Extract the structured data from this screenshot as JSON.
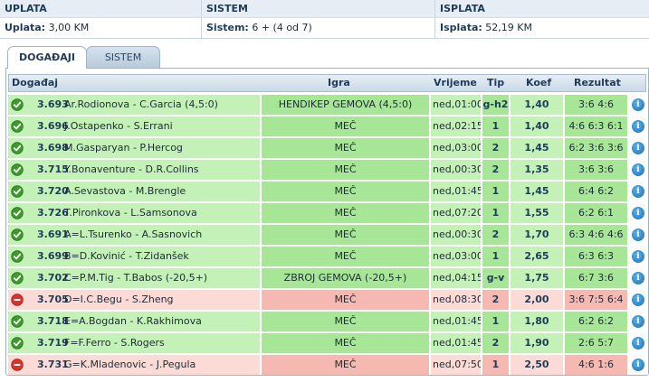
{
  "summary": {
    "uplata_header": "UPLATA",
    "sistem_header": "SISTEM",
    "isplata_header": "ISPLATA",
    "uplata_label": "Uplata:",
    "uplata_value": "3,00 KM",
    "sistem_label": "Sistem:",
    "sistem_value": "6 + (4 od 7)",
    "isplata_label": "Isplata:",
    "isplata_value": "52,19 KM"
  },
  "tabs": [
    {
      "label": "DOGAĐAJI",
      "active": true
    },
    {
      "label": "SISTEM",
      "active": false
    }
  ],
  "columns": {
    "event": "Događaj",
    "igra": "Igra",
    "vrijeme": "Vrijeme",
    "tip": "Tip",
    "koef": "Koef",
    "rezultat": "Rezultat"
  },
  "colors": {
    "won_light": "#c3f1b7",
    "won_dark": "#a7e597",
    "lost_light": "#fcdad6",
    "lost_dark": "#f6b9b1",
    "header_text": "#1e3b57"
  },
  "rows": [
    {
      "status": "won",
      "code": "3.693",
      "names": "Ar.Rodionova - C.Garcia (4,5:0)",
      "igra": "HENDIKEP GEMOVA (4,5:0)",
      "vrijeme": "ned,01:00",
      "tip": "g-h2",
      "koef": "1,40",
      "rezultat": "3:6 4:6",
      "info": "i"
    },
    {
      "status": "won",
      "code": "3.696",
      "names": "J.Ostapenko - S.Errani",
      "igra": "MEČ",
      "vrijeme": "ned,02:15",
      "tip": "1",
      "koef": "1,40",
      "rezultat": "4:6 6:3 6:1",
      "info": "i"
    },
    {
      "status": "won",
      "code": "3.698",
      "names": "M.Gasparyan - P.Hercog",
      "igra": "MEČ",
      "vrijeme": "ned,03:00",
      "tip": "2",
      "koef": "1,45",
      "rezultat": "6:2 3:6 3:6",
      "info": "i"
    },
    {
      "status": "won",
      "code": "3.715",
      "names": "Y.Bonaventure - D.R.Collins",
      "igra": "MEČ",
      "vrijeme": "ned,00:30",
      "tip": "2",
      "koef": "1,35",
      "rezultat": "3:6 3:6",
      "info": "i"
    },
    {
      "status": "won",
      "code": "3.720",
      "names": "A.Sevastova - M.Brengle",
      "igra": "MEČ",
      "vrijeme": "ned,01:45",
      "tip": "1",
      "koef": "1,45",
      "rezultat": "6:4 6:2",
      "info": "i"
    },
    {
      "status": "won",
      "code": "3.726",
      "names": "T.Pironkova - L.Samsonova",
      "igra": "MEČ",
      "vrijeme": "ned,07:20",
      "tip": "1",
      "koef": "1,55",
      "rezultat": "6:2 6:1",
      "info": "i"
    },
    {
      "status": "won",
      "code": "3.691",
      "names": "A=L.Tsurenko - A.Sasnovich",
      "igra": "MEČ",
      "vrijeme": "ned,00:30",
      "tip": "2",
      "koef": "1,70",
      "rezultat": "6:3 4:6 4:6",
      "info": "i"
    },
    {
      "status": "won",
      "code": "3.699",
      "names": "B=D.Kovinić - T.Zidanšek",
      "igra": "MEČ",
      "vrijeme": "ned,03:00",
      "tip": "1",
      "koef": "2,65",
      "rezultat": "6:3 6:3",
      "info": "i"
    },
    {
      "status": "won",
      "code": "3.702",
      "names": "C=P.M.Tig - T.Babos (-20,5+)",
      "igra": "ZBROJ GEMOVA (-20,5+)",
      "vrijeme": "ned,04:15",
      "tip": "g-v",
      "koef": "1,75",
      "rezultat": "6:7 3:6",
      "info": "i"
    },
    {
      "status": "lost",
      "code": "3.705",
      "names": "D=I.C.Begu - S.Zheng",
      "igra": "MEČ",
      "vrijeme": "ned,08:30",
      "tip": "2",
      "koef": "2,00",
      "rezultat": "3:6 7:5 6:4",
      "info": "i"
    },
    {
      "status": "won",
      "code": "3.718",
      "names": "E=A.Bogdan - K.Rakhimova",
      "igra": "MEČ",
      "vrijeme": "ned,01:45",
      "tip": "1",
      "koef": "1,80",
      "rezultat": "6:2 6:2",
      "info": "i"
    },
    {
      "status": "won",
      "code": "3.719",
      "names": "F=F.Ferro - S.Rogers",
      "igra": "MEČ",
      "vrijeme": "ned,01:45",
      "tip": "2",
      "koef": "1,90",
      "rezultat": "2:6 5:7",
      "info": "i"
    },
    {
      "status": "lost",
      "code": "3.731",
      "names": "G=K.Mladenovic - J.Pegula",
      "igra": "MEČ",
      "vrijeme": "ned,07:50",
      "tip": "1",
      "koef": "2,50",
      "rezultat": "4:6 1:6",
      "info": "i"
    }
  ]
}
